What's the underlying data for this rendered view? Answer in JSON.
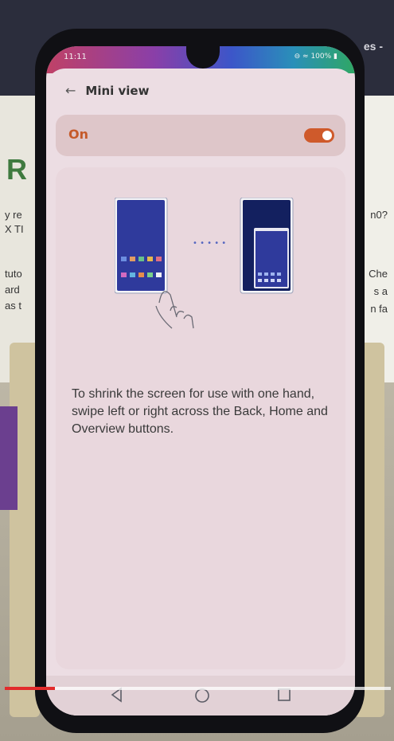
{
  "status_bar": {
    "time": "11:11",
    "icons": "⊖ ≈ 100% ▮"
  },
  "header": {
    "back_icon": "arrow-left-icon",
    "title": "Mini view"
  },
  "toggle": {
    "label": "On",
    "state": true,
    "accent_color": "#cf5a2b"
  },
  "description": "To shrink the screen for use with one hand, swipe left or right across the Back, Home and Overview buttons.",
  "illustration": {
    "separator": "• • • • •"
  },
  "navigation_bar": {
    "buttons": [
      "back-icon",
      "home-icon",
      "overview-icon"
    ]
  },
  "video_progress": {
    "fraction": 0.13,
    "color": "#e22b2b"
  }
}
